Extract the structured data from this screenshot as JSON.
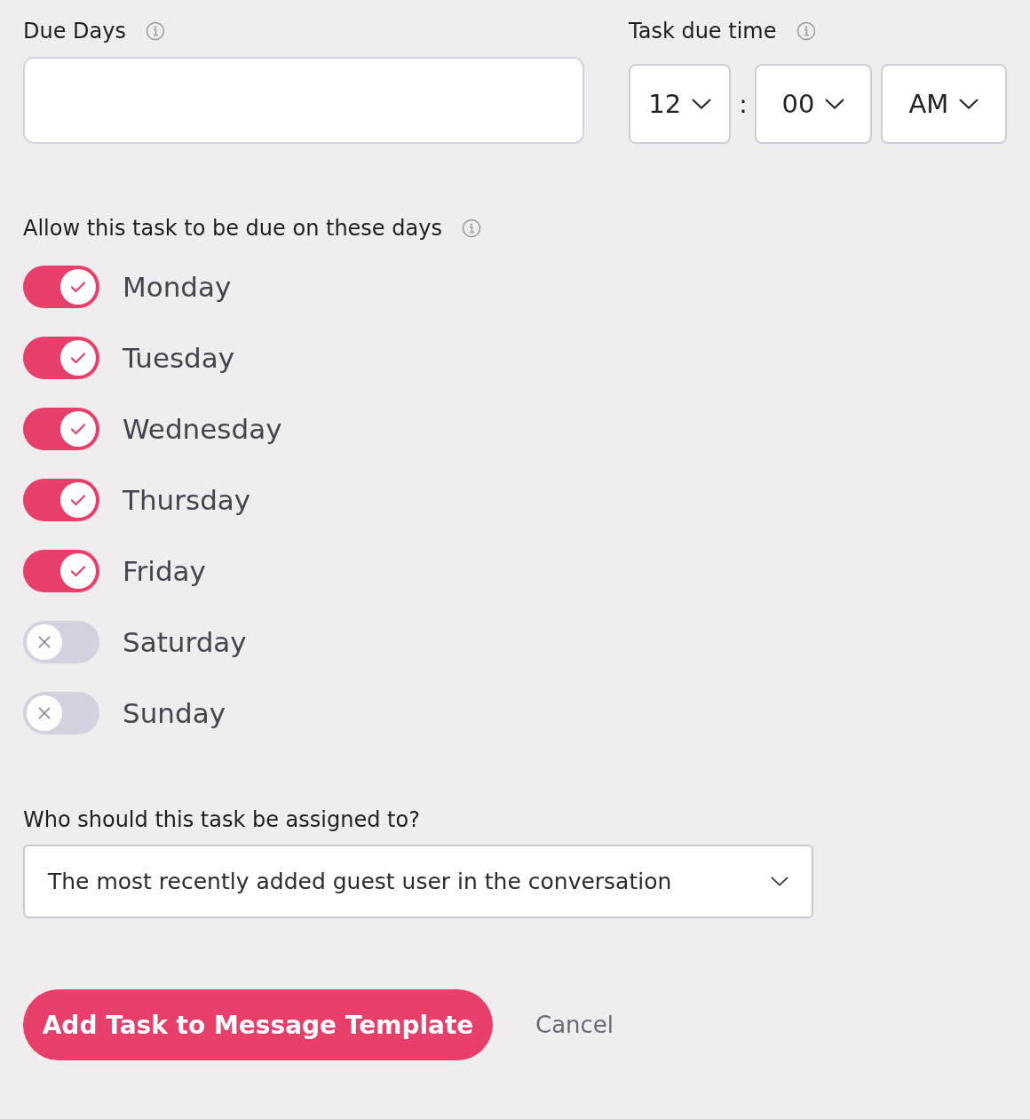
{
  "due_days": {
    "label": "Due Days"
  },
  "due_time": {
    "label": "Task due time",
    "hour": "12",
    "separator": ":",
    "minute": "00",
    "period": "AM"
  },
  "days_section": {
    "label": "Allow this task to be due on these days"
  },
  "days": [
    {
      "name": "Monday",
      "on": true
    },
    {
      "name": "Tuesday",
      "on": true
    },
    {
      "name": "Wednesday",
      "on": true
    },
    {
      "name": "Thursday",
      "on": true
    },
    {
      "name": "Friday",
      "on": true
    },
    {
      "name": "Saturday",
      "on": false
    },
    {
      "name": "Sunday",
      "on": false
    }
  ],
  "assignee": {
    "label": "Who should this task be assigned to?",
    "value": "The most recently added guest user in the conversation"
  },
  "buttons": {
    "primary": "Add Task to Message Template",
    "cancel": "Cancel"
  }
}
